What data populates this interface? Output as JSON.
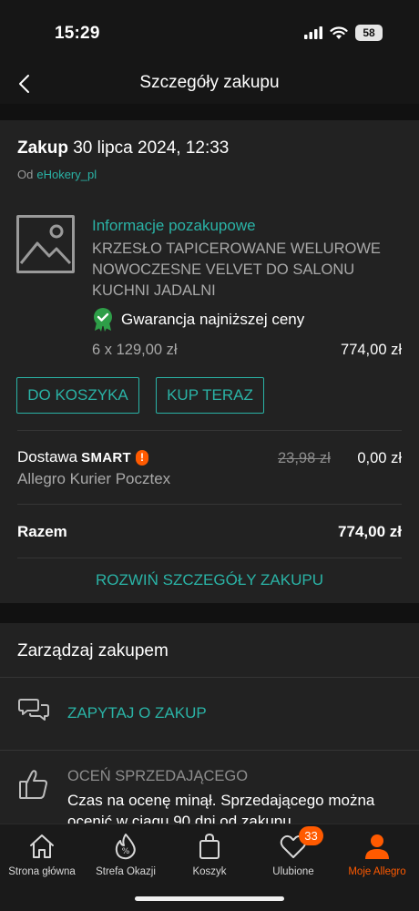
{
  "status": {
    "time": "15:29",
    "battery": "58"
  },
  "nav": {
    "title": "Szczegóły zakupu"
  },
  "order": {
    "label": "Zakup",
    "date": "30 lipca 2024, 12:33",
    "seller_prefix": "Od",
    "seller": "eHokery_pl"
  },
  "item": {
    "info_link": "Informacje pozakupowe",
    "name": "KRZESŁO TAPICEROWANE WELUROWE NOWOCZESNE VELVET DO SALONU KUCHNI JADALNI",
    "guarantee": "Gwarancja najniższej ceny",
    "qty_price": "6 x 129,00 zł",
    "line_total": "774,00 zł",
    "btn_cart": "DO KOSZYKA",
    "btn_buy": "KUP TERAZ"
  },
  "delivery": {
    "label": "Dostawa",
    "smart": "SMART",
    "smart_mark": "!",
    "courier": "Allegro Kurier Pocztex",
    "old_price": "23,98 zł",
    "price": "0,00 zł"
  },
  "total": {
    "label": "Razem",
    "value": "774,00 zł"
  },
  "expand": "ROZWIŃ SZCZEGÓŁY ZAKUPU",
  "manage": {
    "title": "Zarządzaj zakupem",
    "ask": "ZAPYTAJ O ZAKUP",
    "rate_title": "OCEŃ SPRZEDAJĄCEGO",
    "rate_desc": "Czas na ocenę minął. Sprzedającego można ocenić w ciągu 90 dni od zakupu."
  },
  "tabs": [
    {
      "label": "Strona główna",
      "icon": "home-icon"
    },
    {
      "label": "Strefa Okazji",
      "icon": "deals-icon"
    },
    {
      "label": "Koszyk",
      "icon": "cart-icon"
    },
    {
      "label": "Ulubione",
      "icon": "heart-icon",
      "badge": "33"
    },
    {
      "label": "Moje Allegro",
      "icon": "user-icon",
      "active": true
    }
  ],
  "colors": {
    "accent": "#2ab3a6",
    "brand": "#ff5a00",
    "guarantee_green": "#2e9e48"
  }
}
